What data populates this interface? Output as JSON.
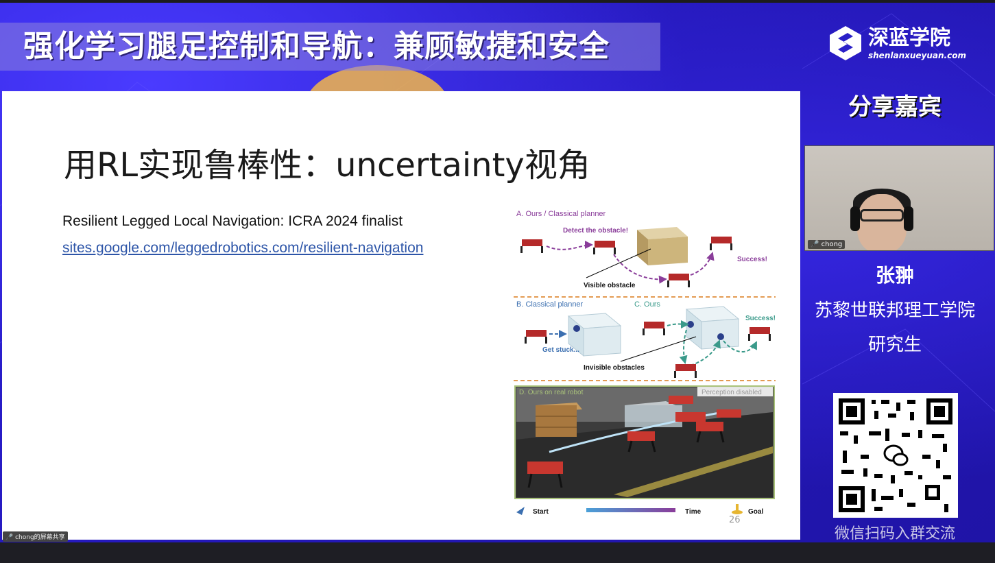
{
  "banner": {
    "title": "强化学习腿足控制和导航：兼顾敏捷和安全"
  },
  "brand": {
    "name": "深蓝学院",
    "url_text": "shenlanxueyuan.com"
  },
  "guest_panel": {
    "heading": "分享嘉宾",
    "video_label": "chong",
    "name": "张翀",
    "organization": "苏黎世联邦理工学院",
    "role": "研究生",
    "qr_caption": "微信扫码入群交流"
  },
  "slide": {
    "title": "用RL实现鲁棒性：uncertainty视角",
    "reference": "Resilient Legged Local Navigation: ICRA 2024 finalist",
    "link": "sites.google.com/leggedrobotics.com/resilient-navigation",
    "page_number": "26",
    "figure": {
      "panel_a_label": "A. Ours / Classical planner",
      "detect_label": "Detect the obstacle!",
      "visible_obstacle": "Visible obstacle",
      "success_a": "Success!",
      "panel_b_label": "B. Classical planner",
      "panel_c_label": "C. Ours",
      "get_stuck": "Get stuck...",
      "invisible_obstacles": "Invisible obstacles",
      "success_c": "Success!",
      "panel_d_label": "D. Ours on real robot",
      "perception_disabled": "Perception disabled",
      "legend_start": "Start",
      "legend_time": "Time",
      "legend_goal": "Goal"
    }
  },
  "participant_label": "chong的屏幕共享",
  "colors": {
    "background": "#2a20c8",
    "accent_purple": "#8a3d9a",
    "accent_teal": "#3a9a8a",
    "robot_red": "#b52a2a"
  }
}
